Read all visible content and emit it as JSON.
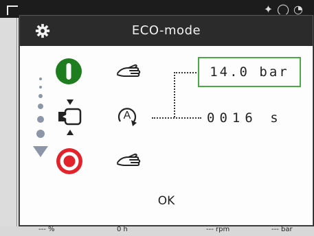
{
  "dialog": {
    "title": "ECO-mode",
    "pressure_value": "14.0 bar",
    "time_value": "0016 s",
    "ok_label": "OK"
  },
  "icons": {
    "header": "gear-icon",
    "row1_state": "green-start-icon",
    "row1_mode": "manual-hand-icon",
    "row2_state": "valve-transition-icon",
    "row2_mode": "automatic-a-icon",
    "row3_state": "red-stop-icon",
    "row3_mode": "manual-hand-icon"
  },
  "background_status": {
    "percent": "--- %",
    "hours": "0 h",
    "rpm": "--- rpm",
    "bar": "--- bar"
  },
  "colors": {
    "header_bg": "#2b2b2b",
    "green": "#1e7d1e",
    "red": "#e3232b",
    "highlight_box": "#49a943",
    "step_dots": "#8c96a8"
  }
}
